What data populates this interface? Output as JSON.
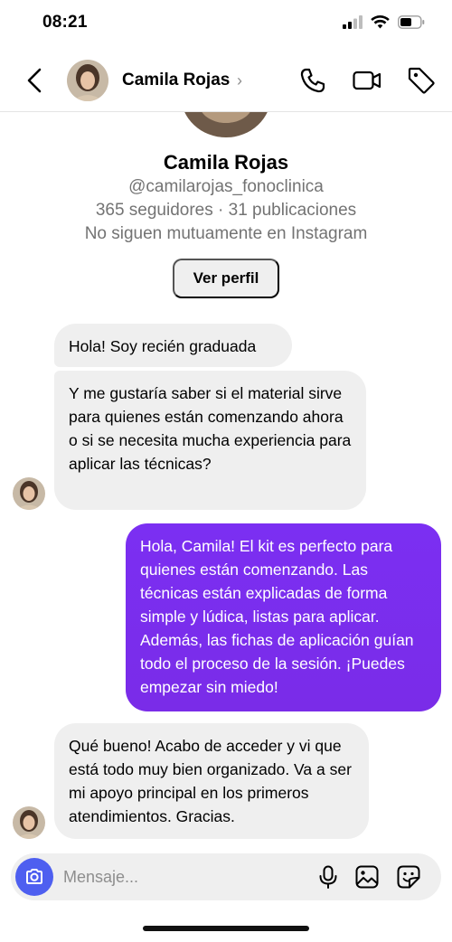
{
  "status_bar": {
    "time": "08:21"
  },
  "header": {
    "contact_name": "Camila Rojas",
    "chevron": "›"
  },
  "profile": {
    "name": "Camila Rojas",
    "handle": "@camilarojas_fonoclinica",
    "stats": "365 seguidores · 31 publicaciones",
    "relation": "No siguen mutuamente en Instagram",
    "view_profile_label": "Ver perfil"
  },
  "messages": [
    {
      "sender": "Camila Rojas",
      "direction": "incoming",
      "text": "Hola! Soy recién graduada"
    },
    {
      "sender": "Camila Rojas",
      "direction": "incoming",
      "text": "Y me gustaría saber si el material sirve para quienes están comenzando ahora o si se necesita mucha experiencia para aplicar las técnicas?"
    },
    {
      "sender": "me",
      "direction": "outgoing",
      "text": "Hola, Camila! El kit es perfecto para quienes están comenzando. Las técnicas están explicadas de forma simple y lúdica, listas para aplicar. Además, las fichas de aplicación guían todo el proceso de la sesión. ¡Puedes empezar sin miedo!"
    },
    {
      "sender": "Camila Rojas",
      "direction": "incoming",
      "text": "Qué bueno! Acabo de acceder y vi que está todo muy bien organizado. Va a ser mi apoyo principal en los primeros atendimientos. Gracias."
    }
  ],
  "composer": {
    "placeholder": "Mensaje..."
  },
  "icons": {
    "back": "chevron-left-icon",
    "call": "phone-icon",
    "video": "video-camera-icon",
    "tag": "tag-icon",
    "camera": "camera-icon",
    "mic": "microphone-icon",
    "gallery": "image-icon",
    "sticker": "sticker-icon"
  },
  "colors": {
    "outgoing_bubble": "#7a2cf0",
    "incoming_bubble": "#efefef",
    "camera_button": "#4e5ff0",
    "secondary_text": "#737373"
  }
}
